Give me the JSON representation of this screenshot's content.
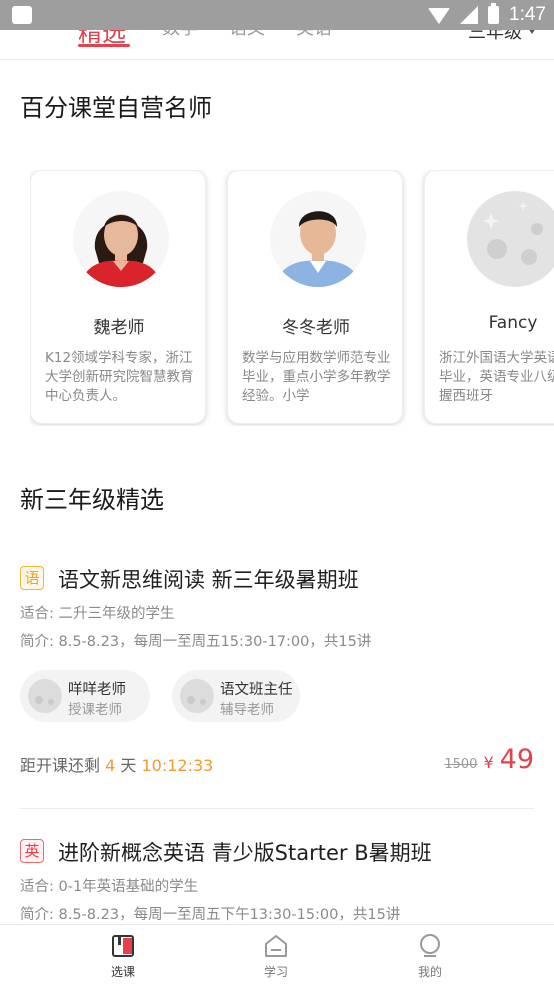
{
  "status_bar": {
    "time": "1:47"
  },
  "tabs": [
    {
      "label": "精选",
      "active": true
    },
    {
      "label": "数学",
      "active": false
    },
    {
      "label": "语文",
      "active": false
    },
    {
      "label": "英语",
      "active": false
    }
  ],
  "grade_selector": {
    "label": "三年级"
  },
  "teachers_section": {
    "title": "百分课堂自营名师",
    "teachers": [
      {
        "name": "魏老师",
        "desc": "K12领域学科专家，浙江大学创新研究院智慧教育中心负责人。"
      },
      {
        "name": "冬冬老师",
        "desc": "数学与应用数学师范专业毕业，重点小学多年教学经验。小学"
      },
      {
        "name": "Fancy",
        "desc": "浙江外国语大学英语师范毕业，英语专业八级。掌握西班牙"
      }
    ]
  },
  "courses_section": {
    "title": "新三年级精选",
    "courses": [
      {
        "badge": "语",
        "title": "语文新思维阅读 新三年级暑期班",
        "suitable": "适合: 二升三年级的学生",
        "intro": "简介: 8.5-8.23，每周一至周五15:30-17:00，共15讲",
        "teachers": [
          {
            "name": "咩咩老师",
            "role": "授课老师"
          },
          {
            "name": "语文班主任",
            "role": "辅导老师"
          }
        ],
        "countdown_prefix": "距开课还剩",
        "countdown_days": "4",
        "countdown_days_unit": "天",
        "countdown_time": "10:12:33",
        "old_price": "1500",
        "currency": "¥",
        "price": "49"
      },
      {
        "badge": "英",
        "title": "进阶新概念英语 青少版Starter B暑期班",
        "suitable": "适合: 0-1年英语基础的学生",
        "intro": "简介: 8.5-8.23，每周一至周五下午13:30-15:00，共15讲"
      }
    ]
  },
  "bottom_nav": [
    {
      "label": "选课",
      "icon": "course-select-icon",
      "active": true
    },
    {
      "label": "学习",
      "icon": "study-icon",
      "active": false
    },
    {
      "label": "我的",
      "icon": "profile-icon",
      "active": false
    }
  ],
  "colors": {
    "accent": "#e2414d",
    "countdown": "#f29a33",
    "status_bar": "#9e9e9e"
  }
}
